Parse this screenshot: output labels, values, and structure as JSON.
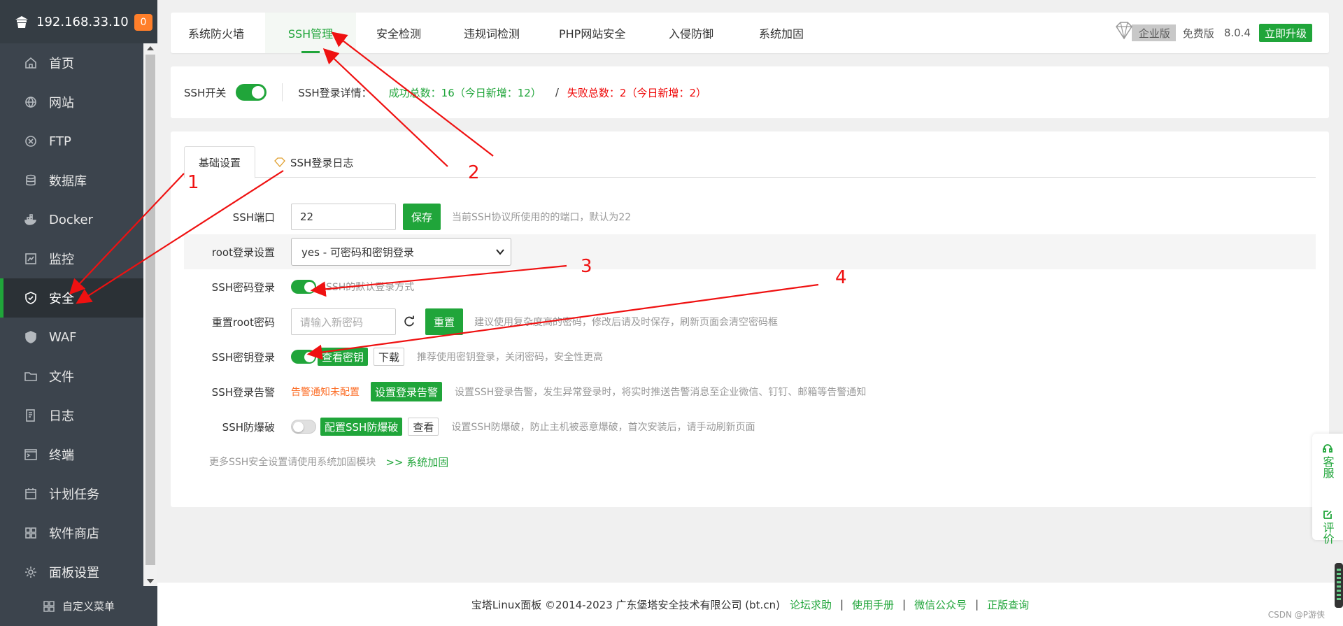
{
  "sidebar": {
    "ip": "192.168.33.10",
    "badge": "0",
    "items": [
      {
        "label": "首页",
        "icon": "home-icon"
      },
      {
        "label": "网站",
        "icon": "globe-icon"
      },
      {
        "label": "FTP",
        "icon": "ftp-icon"
      },
      {
        "label": "数据库",
        "icon": "database-icon"
      },
      {
        "label": "Docker",
        "icon": "docker-icon"
      },
      {
        "label": "监控",
        "icon": "monitor-icon"
      },
      {
        "label": "安全",
        "icon": "shield-icon"
      },
      {
        "label": "WAF",
        "icon": "waf-shield-icon"
      },
      {
        "label": "文件",
        "icon": "folder-icon"
      },
      {
        "label": "日志",
        "icon": "log-icon"
      },
      {
        "label": "终端",
        "icon": "terminal-icon"
      },
      {
        "label": "计划任务",
        "icon": "calendar-icon"
      },
      {
        "label": "软件商店",
        "icon": "apps-icon"
      },
      {
        "label": "面板设置",
        "icon": "gear-icon"
      }
    ],
    "active_index": 6,
    "custom_menu": "自定义菜单"
  },
  "topnav": {
    "tabs": [
      "系统防火墙",
      "SSH管理",
      "安全检测",
      "违规词检测",
      "PHP网站安全",
      "入侵防御",
      "系统加固"
    ],
    "active_tab": "SSH管理",
    "enterprise": "企业版",
    "free": "免费版",
    "version": "8.0.4",
    "upgrade": "立即升级"
  },
  "status": {
    "ssh_switch_label": "SSH开关",
    "login_detail_label": "SSH登录详情：",
    "success": "成功总数：16（今日新增：12）",
    "slash": "/",
    "fail": "失败总数：2（今日新增：2）"
  },
  "card": {
    "tabs": [
      "基础设置",
      "SSH登录日志"
    ],
    "port": {
      "label": "SSH端口",
      "value": "22",
      "button": "保存",
      "hint": "当前SSH协议所使用的的端口，默认为22"
    },
    "root_login": {
      "label": "root登录设置",
      "selected": "yes - 可密码和密钥登录"
    },
    "pwd_login": {
      "label": "SSH密码登录",
      "hint": "SSH的默认登录方式"
    },
    "reset_root": {
      "label": "重置root密码",
      "placeholder": "请输入新密码",
      "button": "重置",
      "hint": "建议使用复杂度高的密码，修改后请及时保存，刷新页面会清空密码框"
    },
    "key_login": {
      "label": "SSH密钥登录",
      "view": "查看密钥",
      "download": "下载",
      "hint": "推荐使用密钥登录，关闭密码，安全性更高"
    },
    "alert": {
      "label": "SSH登录告警",
      "status": "告警通知未配置",
      "button": "设置登录告警",
      "hint": "设置SSH登录告警，发生异常登录时，将实时推送告警消息至企业微信、钉钉、邮箱等告警通知"
    },
    "brute": {
      "label": "SSH防爆破",
      "button": "配置SSH防爆破",
      "view": "查看",
      "hint": "设置SSH防爆破，防止主机被恶意爆破，首次安装后，请手动刷新页面"
    },
    "more": {
      "text": "更多SSH安全设置请使用系统加固模块",
      "link": ">> 系统加固"
    }
  },
  "footer": {
    "copyright": "宝塔Linux面板 ©2014-2023 广东堡塔安全技术有限公司 (bt.cn)",
    "links": [
      "论坛求助",
      "使用手册",
      "微信公众号",
      "正版查询"
    ],
    "sep": "|",
    "watermark": "CSDN @P游侠"
  },
  "float": {
    "service": "客服",
    "review": "评价"
  },
  "annotations": [
    "1",
    "2",
    "3",
    "4"
  ],
  "colors": {
    "accent": "#20a53a",
    "fail": "#ef0808",
    "warn": "#fc6d26",
    "arrow": "#ef1111"
  }
}
